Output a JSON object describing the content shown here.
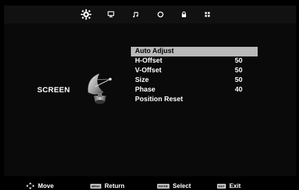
{
  "top_icons": [
    {
      "name": "picture-settings-icon",
      "glyph": "✲",
      "active": true
    },
    {
      "name": "display-icon",
      "glyph": "▭",
      "active": false
    },
    {
      "name": "music-icon",
      "glyph": "♫",
      "active": false
    },
    {
      "name": "clock-icon",
      "glyph": "◉",
      "active": false
    },
    {
      "name": "lock-icon",
      "glyph": "🔒",
      "active": false
    },
    {
      "name": "grid-icon",
      "glyph": "⠿",
      "active": false
    }
  ],
  "menu": {
    "title": "SCREEN",
    "items": [
      {
        "label": "Auto Adjust",
        "value": "",
        "selected": true
      },
      {
        "label": "H-Offset",
        "value": "50",
        "selected": false
      },
      {
        "label": "V-Offset",
        "value": "50",
        "selected": false
      },
      {
        "label": "Size",
        "value": "50",
        "selected": false
      },
      {
        "label": "Phase",
        "value": "40",
        "selected": false
      },
      {
        "label": "Position Reset",
        "value": "",
        "selected": false
      }
    ]
  },
  "footer": {
    "move": {
      "label": "Move"
    },
    "return": {
      "key": "MENU",
      "label": "Return"
    },
    "select": {
      "key": "ENTER",
      "label": "Select"
    },
    "exit": {
      "key": "EXIT",
      "label": "Exit"
    }
  },
  "colors": {
    "background": "#000000",
    "highlight": "#b9b9b9",
    "text": "#ffffff"
  }
}
